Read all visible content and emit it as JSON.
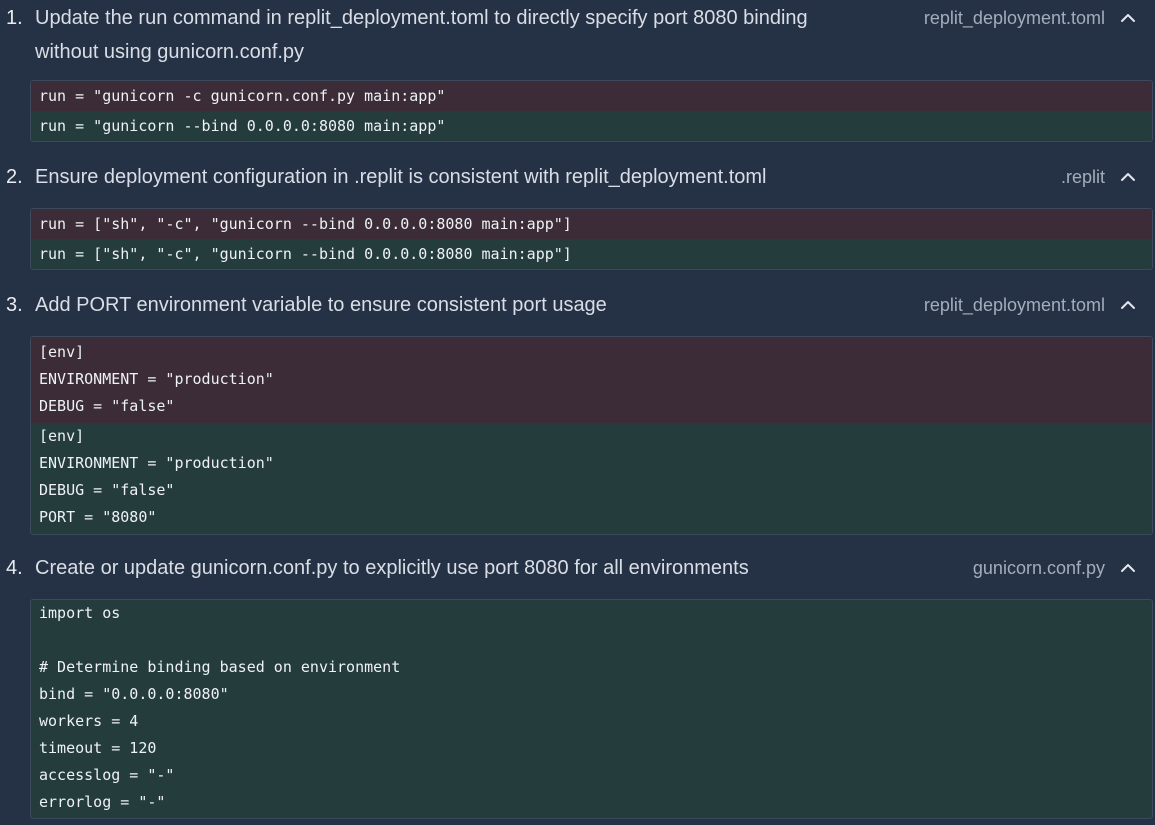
{
  "steps": [
    {
      "number": "1.",
      "title_lines": [
        "Update the run command in replit_deployment.toml to directly specify port 8080 binding",
        "without using gunicorn.conf.py"
      ],
      "file": "replit_deployment.toml",
      "removed": [
        "run = \"gunicorn -c gunicorn.conf.py main:app\""
      ],
      "added": [
        "run = \"gunicorn --bind 0.0.0.0:8080 main:app\""
      ]
    },
    {
      "number": "2.",
      "title": "Ensure deployment configuration in .replit is consistent with replit_deployment.toml",
      "file": ".replit",
      "removed": [
        "run = [\"sh\", \"-c\", \"gunicorn --bind 0.0.0.0:8080 main:app\"]"
      ],
      "added": [
        "run = [\"sh\", \"-c\", \"gunicorn --bind 0.0.0.0:8080 main:app\"]"
      ]
    },
    {
      "number": "3.",
      "title": "Add PORT environment variable to ensure consistent port usage",
      "file": "replit_deployment.toml",
      "removed": [
        "[env]",
        "ENVIRONMENT = \"production\"",
        "DEBUG = \"false\""
      ],
      "added": [
        "[env]",
        "ENVIRONMENT = \"production\"",
        "DEBUG = \"false\"",
        "PORT = \"8080\""
      ]
    },
    {
      "number": "4.",
      "title": "Create or update gunicorn.conf.py to explicitly use port 8080 for all environments",
      "file": "gunicorn.conf.py",
      "code": [
        "import os",
        "",
        "# Determine binding based on environment",
        "bind = \"0.0.0.0:8080\"",
        "workers = 4",
        "timeout = 120",
        "accesslog = \"-\"",
        "errorlog = \"-\""
      ]
    }
  ],
  "icons": {
    "collapse": "chevron-up-icon"
  },
  "colors": {
    "background": "#253245",
    "removed_bg": "#3b2c37",
    "added_bg": "#253c3d"
  }
}
